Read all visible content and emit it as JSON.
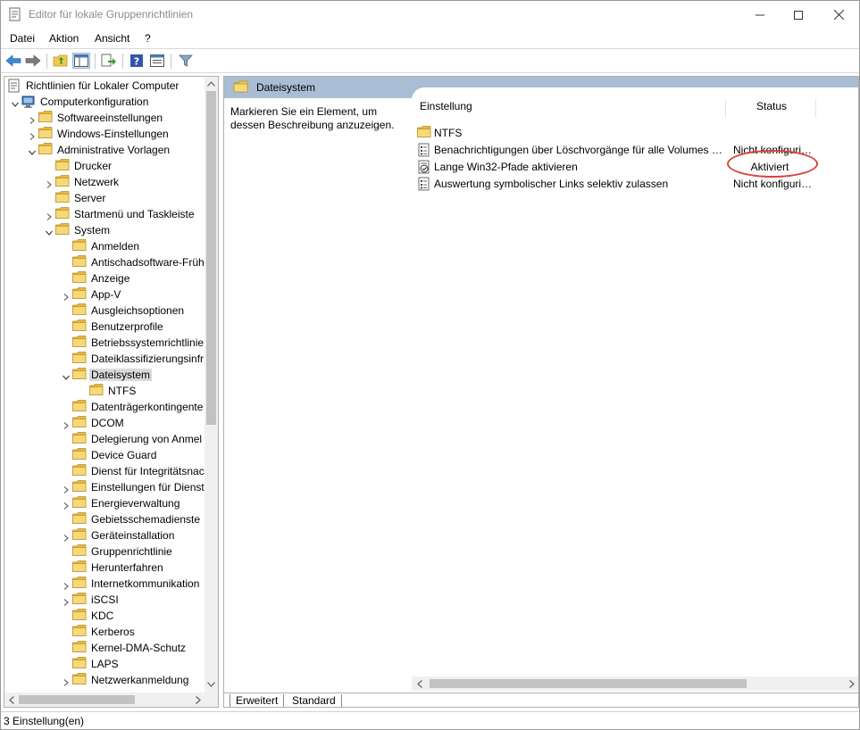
{
  "window": {
    "title": "Editor für lokale Gruppenrichtlinien",
    "controls": {
      "minimize": "—",
      "maximize": "☐",
      "close": "✕"
    }
  },
  "menu": [
    "Datei",
    "Aktion",
    "Ansicht",
    "?"
  ],
  "toolbar": {
    "buttons": [
      "back-icon",
      "forward-icon",
      "up-folder-icon",
      "show-hide-tree-icon",
      "export-list-icon",
      "help-icon",
      "properties-icon",
      "filter-icon"
    ]
  },
  "tree": {
    "items": [
      {
        "label": "Richtlinien für Lokaler Computer",
        "level": 0,
        "expander": "none",
        "icon": "policy-doc-icon"
      },
      {
        "label": "Computerkonfiguration",
        "level": 1,
        "expander": "expanded",
        "icon": "computer-icon"
      },
      {
        "label": "Softwareeinstellungen",
        "level": 2,
        "expander": "collapsed",
        "icon": "folder-icon"
      },
      {
        "label": "Windows-Einstellungen",
        "level": 2,
        "expander": "collapsed",
        "icon": "folder-icon"
      },
      {
        "label": "Administrative Vorlagen",
        "level": 2,
        "expander": "expanded",
        "icon": "folder-icon"
      },
      {
        "label": "Drucker",
        "level": 3,
        "expander": "none",
        "icon": "folder-icon"
      },
      {
        "label": "Netzwerk",
        "level": 3,
        "expander": "collapsed",
        "icon": "folder-icon"
      },
      {
        "label": "Server",
        "level": 3,
        "expander": "none",
        "icon": "folder-icon"
      },
      {
        "label": "Startmenü und Taskleiste",
        "level": 3,
        "expander": "collapsed",
        "icon": "folder-icon"
      },
      {
        "label": "System",
        "level": 3,
        "expander": "expanded",
        "icon": "folder-icon"
      },
      {
        "label": "Anmelden",
        "level": 4,
        "expander": "none",
        "icon": "folder-icon"
      },
      {
        "label": "Antischadsoftware-Früh",
        "level": 4,
        "expander": "none",
        "icon": "folder-icon"
      },
      {
        "label": "Anzeige",
        "level": 4,
        "expander": "none",
        "icon": "folder-icon"
      },
      {
        "label": "App-V",
        "level": 4,
        "expander": "collapsed",
        "icon": "folder-icon"
      },
      {
        "label": "Ausgleichsoptionen",
        "level": 4,
        "expander": "none",
        "icon": "folder-icon"
      },
      {
        "label": "Benutzerprofile",
        "level": 4,
        "expander": "none",
        "icon": "folder-icon"
      },
      {
        "label": "Betriebssystemrichtlinie",
        "level": 4,
        "expander": "none",
        "icon": "folder-icon"
      },
      {
        "label": "Dateiklassifizierungsinfr",
        "level": 4,
        "expander": "none",
        "icon": "folder-icon"
      },
      {
        "label": "Dateisystem",
        "level": 4,
        "expander": "expanded",
        "icon": "folder-icon",
        "selected": true
      },
      {
        "label": "NTFS",
        "level": 5,
        "expander": "none",
        "icon": "folder-icon"
      },
      {
        "label": "Datenträgerkontingente",
        "level": 4,
        "expander": "none",
        "icon": "folder-icon"
      },
      {
        "label": "DCOM",
        "level": 4,
        "expander": "collapsed",
        "icon": "folder-icon"
      },
      {
        "label": "Delegierung von Anmel",
        "level": 4,
        "expander": "none",
        "icon": "folder-icon"
      },
      {
        "label": "Device Guard",
        "level": 4,
        "expander": "none",
        "icon": "folder-icon"
      },
      {
        "label": "Dienst für Integritätsnac",
        "level": 4,
        "expander": "none",
        "icon": "folder-icon"
      },
      {
        "label": "Einstellungen für Dienst",
        "level": 4,
        "expander": "collapsed",
        "icon": "folder-icon"
      },
      {
        "label": "Energieverwaltung",
        "level": 4,
        "expander": "collapsed",
        "icon": "folder-icon"
      },
      {
        "label": "Gebietsschemadienste",
        "level": 4,
        "expander": "none",
        "icon": "folder-icon"
      },
      {
        "label": "Geräteinstallation",
        "level": 4,
        "expander": "collapsed",
        "icon": "folder-icon"
      },
      {
        "label": "Gruppenrichtlinie",
        "level": 4,
        "expander": "none",
        "icon": "folder-icon"
      },
      {
        "label": "Herunterfahren",
        "level": 4,
        "expander": "none",
        "icon": "folder-icon"
      },
      {
        "label": "Internetkommunikation",
        "level": 4,
        "expander": "collapsed",
        "icon": "folder-icon"
      },
      {
        "label": "iSCSI",
        "level": 4,
        "expander": "collapsed",
        "icon": "folder-icon"
      },
      {
        "label": "KDC",
        "level": 4,
        "expander": "none",
        "icon": "folder-icon"
      },
      {
        "label": "Kerberos",
        "level": 4,
        "expander": "none",
        "icon": "folder-icon"
      },
      {
        "label": "Kernel-DMA-Schutz",
        "level": 4,
        "expander": "none",
        "icon": "folder-icon"
      },
      {
        "label": "LAPS",
        "level": 4,
        "expander": "none",
        "icon": "folder-icon"
      },
      {
        "label": "Netzwerkanmeldung",
        "level": 4,
        "expander": "collapsed",
        "icon": "folder-icon"
      }
    ]
  },
  "right": {
    "header_title": "Dateisystem",
    "description": "Markieren Sie ein Element, um dessen Beschreibung anzuzeigen.",
    "columns": [
      "Einstellung",
      "Status"
    ],
    "rows": [
      {
        "name": "NTFS",
        "status": "",
        "icon": "folder-icon"
      },
      {
        "name": "Benachrichtigungen über Löschvorgänge für alle Volumes deaktivieren",
        "status": "Nicht konfiguriert",
        "icon": "policy-setting-icon"
      },
      {
        "name": "Lange Win32-Pfade aktivieren",
        "status": "Aktiviert",
        "icon": "policy-enabled-icon",
        "center_status": true
      },
      {
        "name": "Auswertung symbolischer Links selektiv zulassen",
        "status": "Nicht konfiguriert",
        "icon": "policy-setting-icon"
      }
    ],
    "tabs": [
      "Erweitert",
      "Standard"
    ]
  },
  "statusbar": {
    "text": "3 Einstellung(en)"
  },
  "colors": {
    "header_bg": "#a9bdd4",
    "annotation": "#d9413f",
    "folder": "#f2c94c",
    "selected_bg": "#d9d9d9"
  }
}
